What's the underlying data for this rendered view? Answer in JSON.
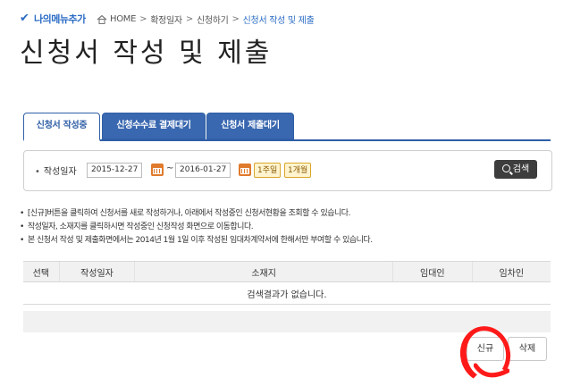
{
  "topbar": {
    "my_menu_label": "나의메뉴추가",
    "breadcrumbs": [
      "HOME",
      "확정일자",
      "신청하기"
    ],
    "current": "신청서 작성 및 제출"
  },
  "page_title": "신청서 작성 및 제출",
  "tabs": [
    {
      "label": "신청서 작성중",
      "active": true
    },
    {
      "label": "신청수수료 결제대기",
      "active": false
    },
    {
      "label": "신청서 제출대기",
      "active": false
    }
  ],
  "search": {
    "label": "작성일자",
    "date_from": "2015-12-27",
    "tilde": "~",
    "date_to": "2016-01-27",
    "quick_week": "1주일",
    "quick_month": "1개월",
    "search_button": "검색"
  },
  "notes": [
    "[신규]버튼을 클릭하여 신청서를 새로 작성하거나, 아래에서 작성중인 신청서현황을 조회할 수 있습니다.",
    "작성일자, 소재지를 클릭하시면 작성중인 신청작성 화면으로 이동합니다.",
    "본 신청서 작성 및 제출화면에서는 2014년 1월 1일 이후 작성된 임대차계약서에 한해서만 부여할 수 있습니다."
  ],
  "note_bullet": "•",
  "table": {
    "columns": [
      "선택",
      "작성일자",
      "소재지",
      "임대인",
      "임차인"
    ],
    "empty_message": "검색결과가 없습니다."
  },
  "actions": {
    "new_label": "신규",
    "delete_label": "삭제"
  },
  "colors": {
    "accent_blue": "#2f5fa6",
    "tab_inactive": "#3a68b0",
    "annotation_red": "#ff1a1a"
  }
}
